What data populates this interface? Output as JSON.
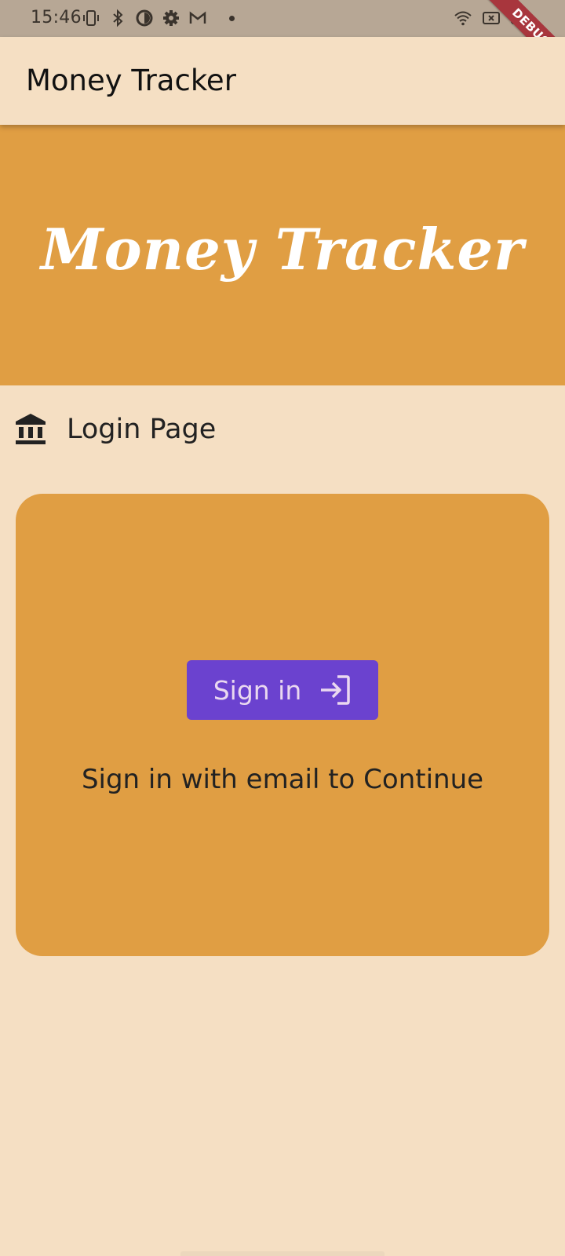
{
  "status_bar": {
    "time": "15:46",
    "left_icons": [
      "vibrate-icon",
      "bluetooth-icon",
      "data-saver-icon",
      "settings-icon",
      "gmail-icon",
      "dot-icon"
    ],
    "right_icons": [
      "wifi-icon",
      "sim-icon",
      "battery-icon"
    ]
  },
  "debug_banner": {
    "label": "DEBUG"
  },
  "app_bar": {
    "title": "Money Tracker"
  },
  "hero": {
    "title": "Money Tracker"
  },
  "login_section": {
    "icon": "bank-icon",
    "label": "Login Page"
  },
  "card": {
    "button_label": "Sign in",
    "button_icon": "login-arrow-icon",
    "caption": "Sign in with email to Continue"
  },
  "colors": {
    "background": "#f5dfc3",
    "accent": "#e09e43",
    "button": "#6b42cf",
    "button_text": "#ead8f0",
    "status_bar": "#b7a795",
    "debug": "#a8363d"
  }
}
